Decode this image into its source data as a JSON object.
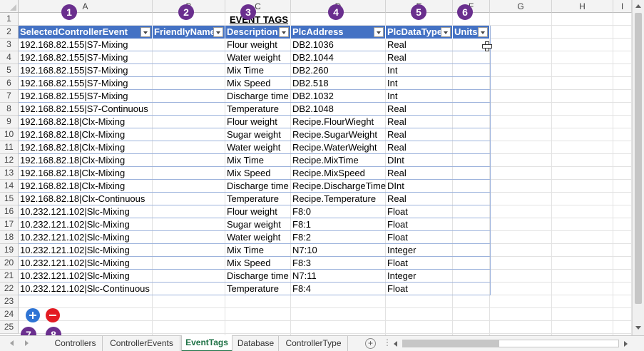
{
  "columns": [
    "A",
    "B",
    "C",
    "D",
    "E",
    "F",
    "G",
    "H",
    "I"
  ],
  "rows": [
    "1",
    "2",
    "3",
    "4",
    "5",
    "6",
    "7",
    "8",
    "9",
    "10",
    "11",
    "12",
    "13",
    "14",
    "15",
    "16",
    "17",
    "18",
    "19",
    "20",
    "21",
    "22",
    "23",
    "24",
    "25"
  ],
  "sheet_title": "EVENT TAGS",
  "table": {
    "headers": [
      "SelectedControllerEvent",
      "FriendlyName",
      "Description",
      "PlcAddress",
      "PlcDataType",
      "Units"
    ],
    "rows": [
      [
        "192.168.82.155|S7-Mixing",
        "",
        "Flour weight",
        "DB2.1036",
        "Real",
        ""
      ],
      [
        "192.168.82.155|S7-Mixing",
        "",
        "Water weight",
        "DB2.1044",
        "Real",
        ""
      ],
      [
        "192.168.82.155|S7-Mixing",
        "",
        "Mix Time",
        "DB2.260",
        "Int",
        ""
      ],
      [
        "192.168.82.155|S7-Mixing",
        "",
        "Mix Speed",
        "DB2.518",
        "Int",
        ""
      ],
      [
        "192.168.82.155|S7-Mixing",
        "",
        "Discharge time",
        "DB2.1032",
        "Int",
        ""
      ],
      [
        "192.168.82.155|S7-Continuous",
        "",
        "Temperature",
        "DB2.1048",
        "Real",
        ""
      ],
      [
        "192.168.82.18|Clx-Mixing",
        "",
        "Flour weight",
        "Recipe.FlourWieght",
        "Real",
        ""
      ],
      [
        "192.168.82.18|Clx-Mixing",
        "",
        "Sugar weight",
        "Recipe.SugarWeight",
        "Real",
        ""
      ],
      [
        "192.168.82.18|Clx-Mixing",
        "",
        "Water weight",
        "Recipe.WaterWeight",
        "Real",
        ""
      ],
      [
        "192.168.82.18|Clx-Mixing",
        "",
        "Mix Time",
        "Recipe.MixTime",
        "DInt",
        ""
      ],
      [
        "192.168.82.18|Clx-Mixing",
        "",
        "Mix Speed",
        "Recipe.MixSpeed",
        "Real",
        ""
      ],
      [
        "192.168.82.18|Clx-Mixing",
        "",
        "Discharge time",
        "Recipe.DischargeTime",
        "DInt",
        ""
      ],
      [
        "192.168.82.18|Clx-Continuous",
        "",
        "Temperature",
        "Recipe.Temperature",
        "Real",
        ""
      ],
      [
        "10.232.121.102|Slc-Mixing",
        "",
        "Flour weight",
        "F8:0",
        "Float",
        ""
      ],
      [
        "10.232.121.102|Slc-Mixing",
        "",
        "Sugar weight",
        "F8:1",
        "Float",
        ""
      ],
      [
        "10.232.121.102|Slc-Mixing",
        "",
        "Water weight",
        "F8:2",
        "Float",
        ""
      ],
      [
        "10.232.121.102|Slc-Mixing",
        "",
        "Mix Time",
        "N7:10",
        "Integer",
        ""
      ],
      [
        "10.232.121.102|Slc-Mixing",
        "",
        "Mix Speed",
        "F8:3",
        "Float",
        ""
      ],
      [
        "10.232.121.102|Slc-Mixing",
        "",
        "Discharge time",
        "N7:11",
        "Integer",
        ""
      ],
      [
        "10.232.121.102|Slc-Continuous",
        "",
        "Temperature",
        "F8:4",
        "Float",
        ""
      ]
    ]
  },
  "annotations": [
    "1",
    "2",
    "3",
    "4",
    "5",
    "6",
    "7",
    "8"
  ],
  "buttons": {
    "add_icon": "plus-icon",
    "remove_icon": "minus-icon"
  },
  "sheet_tabs": [
    "Controllers",
    "ControllerEvents",
    "EventTags",
    "Database",
    "ControllerType"
  ],
  "active_tab": "EventTags",
  "add_sheet_label": "+",
  "more_label": "⋮",
  "colors": {
    "table_header": "#4472c4",
    "table_border": "#9db3dc",
    "annotation_badge": "#6a2f8e",
    "add_button": "#2e74d4",
    "remove_button": "#e31b23",
    "active_tab": "#1e7145"
  }
}
